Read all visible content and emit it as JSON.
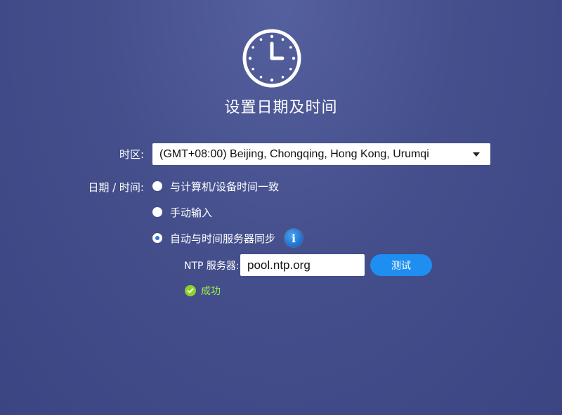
{
  "title": "设置日期及时间",
  "timezone": {
    "label": "时区:",
    "selected": "(GMT+08:00) Beijing, Chongqing, Hong Kong, Urumqi"
  },
  "datetime": {
    "label": "日期 / 时间:",
    "options": [
      {
        "label": "与计算机/设备时间一致",
        "checked": false
      },
      {
        "label": "手动输入",
        "checked": false
      },
      {
        "label": "自动与时间服务器同步",
        "checked": true
      }
    ]
  },
  "ntp": {
    "label": "NTP 服务器:",
    "value": "pool.ntp.org",
    "test_label": "测试"
  },
  "status": {
    "text": "成功"
  },
  "icons": {
    "title_icon": "clock-icon",
    "info": "info-icon",
    "status": "check-circle-icon"
  },
  "colors": {
    "accent": "#1e8ef0",
    "success": "#9ef04a"
  }
}
